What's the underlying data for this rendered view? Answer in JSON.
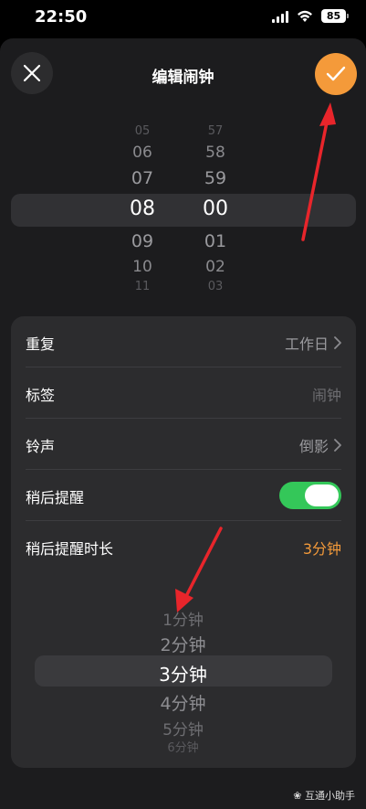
{
  "status": {
    "time": "22:50",
    "battery": "85"
  },
  "header": {
    "title": "编辑闹钟"
  },
  "time_picker": {
    "hours": [
      "05",
      "06",
      "07",
      "08",
      "09",
      "10",
      "11"
    ],
    "minutes": [
      "57",
      "58",
      "59",
      "00",
      "01",
      "02",
      "03"
    ],
    "selected_hour": "08",
    "selected_minute": "00"
  },
  "settings": {
    "repeat_label": "重复",
    "repeat_value": "工作日",
    "tag_label": "标签",
    "tag_placeholder": "闹钟",
    "ringtone_label": "铃声",
    "ringtone_value": "倒影",
    "snooze_label": "稍后提醒",
    "snooze_on": true,
    "snooze_duration_label": "稍后提醒时长",
    "snooze_duration_value": "3分钟"
  },
  "duration_picker": {
    "options": [
      "1分钟",
      "2分钟",
      "3分钟",
      "4分钟",
      "5分钟",
      "6分钟"
    ],
    "selected": "3分钟"
  },
  "watermark": "互通小助手",
  "colors": {
    "accent": "#f49a3a",
    "toggle_on": "#34c759",
    "annotation_arrow": "#e8252b",
    "sheet_bg": "#1c1c1e",
    "card_bg": "#2c2c2e"
  },
  "icons": {
    "close": "close-icon",
    "confirm": "checkmark-icon",
    "chevron": "chevron-right-icon"
  }
}
